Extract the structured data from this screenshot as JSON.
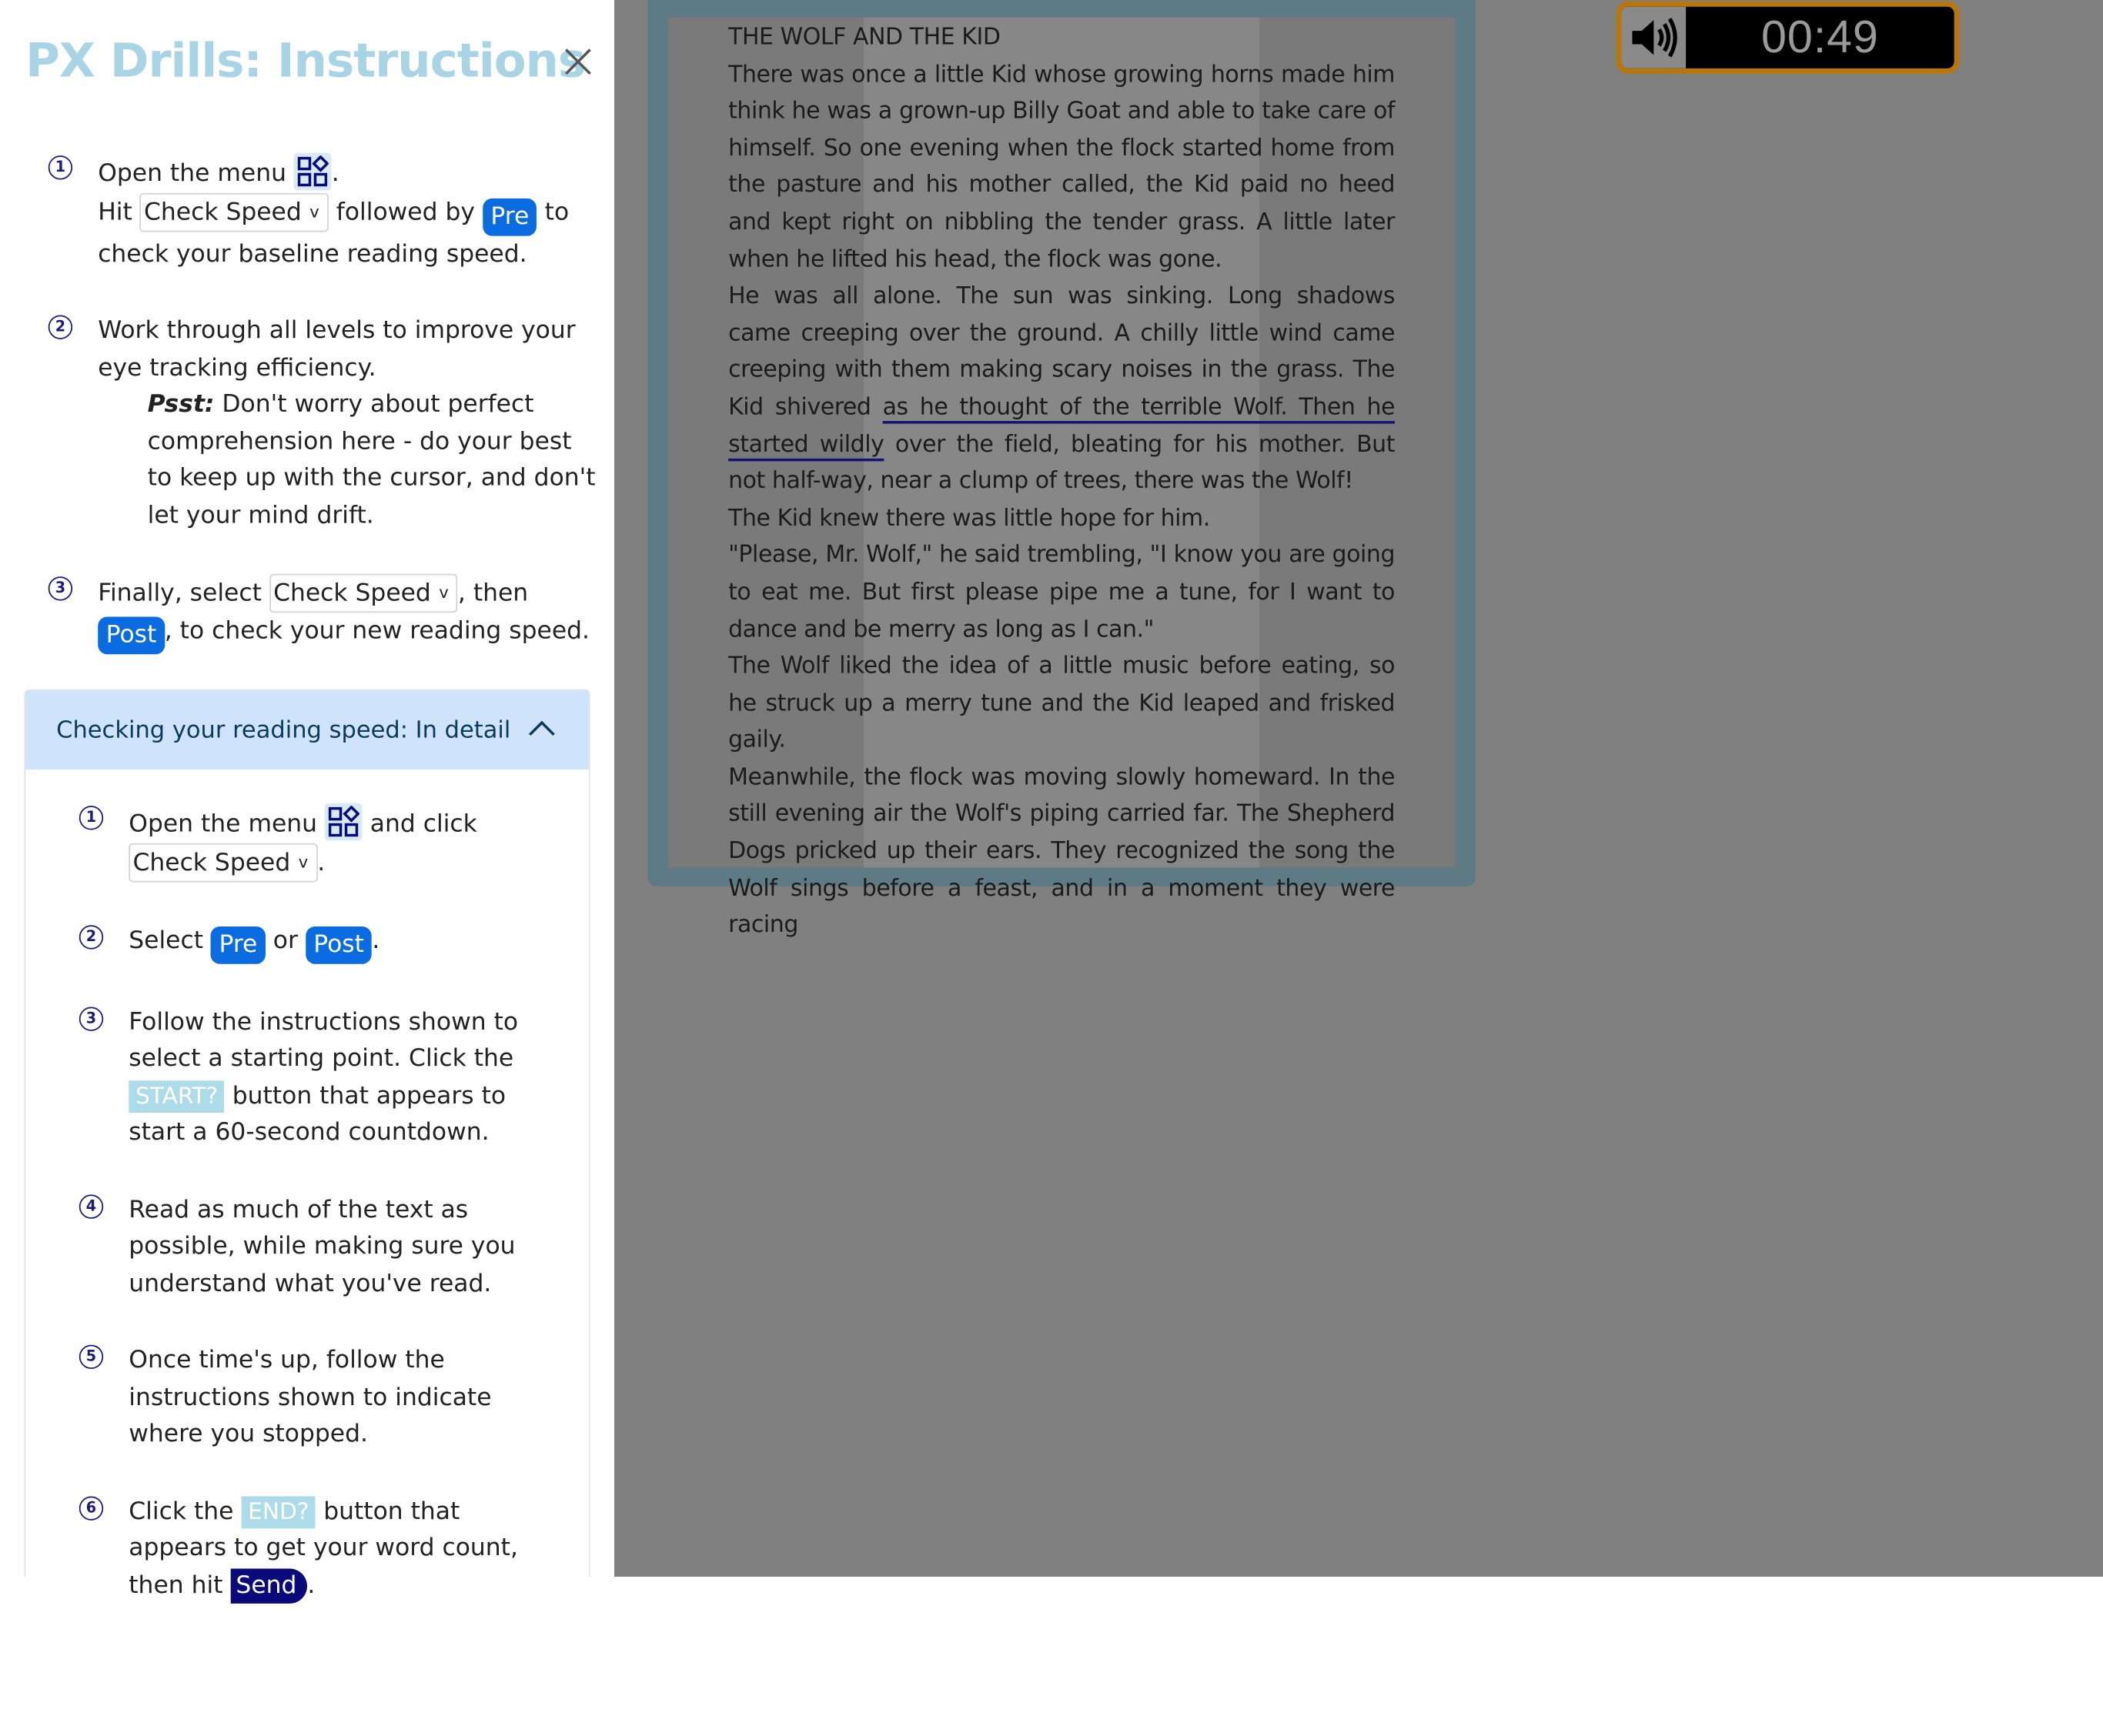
{
  "panel": {
    "title": "PX Drills: Instructions",
    "close_icon": "close-icon",
    "steps": {
      "s1": {
        "num": "1",
        "text_a": "Open the menu ",
        "text_b": ".",
        "text_c": "Hit ",
        "text_d": " followed by ",
        "text_e": " to check your baseline reading speed."
      },
      "s2": {
        "num": "2",
        "text": "Work through all levels to improve your eye tracking efficiency.",
        "psst_label": "Psst:",
        "psst_text": " Don't worry about perfect comprehension here - do your best to keep up with the cursor, and don't let your mind drift."
      },
      "s3": {
        "num": "3",
        "text_a": "Finally, select ",
        "text_b": ", then ",
        "text_c": ", to check your new reading speed."
      }
    },
    "check_speed_label": "Check Speed",
    "pre_label": "Pre",
    "post_label": "Post",
    "accordion": {
      "title": "Checking your reading speed: In detail",
      "d1": {
        "num": "1",
        "text_a": "Open the menu ",
        "text_b": " and click",
        "text_c": "."
      },
      "d2": {
        "num": "2",
        "text_a": "Select ",
        "text_b": " or ",
        "text_c": "."
      },
      "d3": {
        "num": "3",
        "text_a": "Follow the instructions shown to select a starting point. Click the ",
        "start_label": "START?",
        "text_b": " button that appears to start a 60-second countdown."
      },
      "d4": {
        "num": "4",
        "text": "Read as much of the text as possible, while making sure you understand what you've read."
      },
      "d5": {
        "num": "5",
        "text": "Once time's up, follow the instructions shown to indicate where you stopped."
      },
      "d6": {
        "num": "6",
        "text_a": "Click the ",
        "end_label": "END?",
        "text_b": " button that appears to get your word count, then hit ",
        "send_label": "Send",
        "text_c": "."
      }
    }
  },
  "timer": {
    "value": "00:49",
    "icon": "speaker-icon"
  },
  "passage": {
    "title": "THE WOLF AND THE KID",
    "p1": "There was once a little Kid whose growing horns made him think he was a grown-up Billy Goat and able to take care of himself. So one evening when the flock started home from the pasture and his mother called, the Kid paid no heed and kept right on nibbling the tender grass. A little later when he lifted his head, the flock was gone.",
    "p2_a": "He was all alone. The sun was sinking. Long shadows came creeping over the ground. A chilly little wind came creeping with them making scary noises in the grass. The Kid shivered ",
    "p2_cursor": "as he thought of the terrible Wolf. Then he started wildly",
    "p2_b": " over the field, bleating for his mother. But not half-way, near a clump of trees, there was the Wolf!",
    "p3": "The Kid knew there was little hope for him.",
    "p4": "\"Please, Mr. Wolf,\" he said trembling, \"I know you are going to eat me. But first please pipe me a tune, for I want to dance and be merry as long as I can.\"",
    "p5": "The Wolf liked the idea of a little music before eating, so he struck up a merry tune and the Kid leaped and frisked gaily.",
    "p6": "Meanwhile, the flock was moving slowly homeward. In the still evening air the Wolf's piping carried far. The Shepherd Dogs pricked up their ears. They recognized the song the Wolf sings before a feast, and in a moment they were racing"
  },
  "colors": {
    "title": "#a9d4e6",
    "accent_blue": "#0b6be0",
    "navy": "#0a0a7a",
    "accordion_head": "#cfe3fb",
    "timer_border": "#b8760c",
    "overlay_gray": "#808080"
  }
}
